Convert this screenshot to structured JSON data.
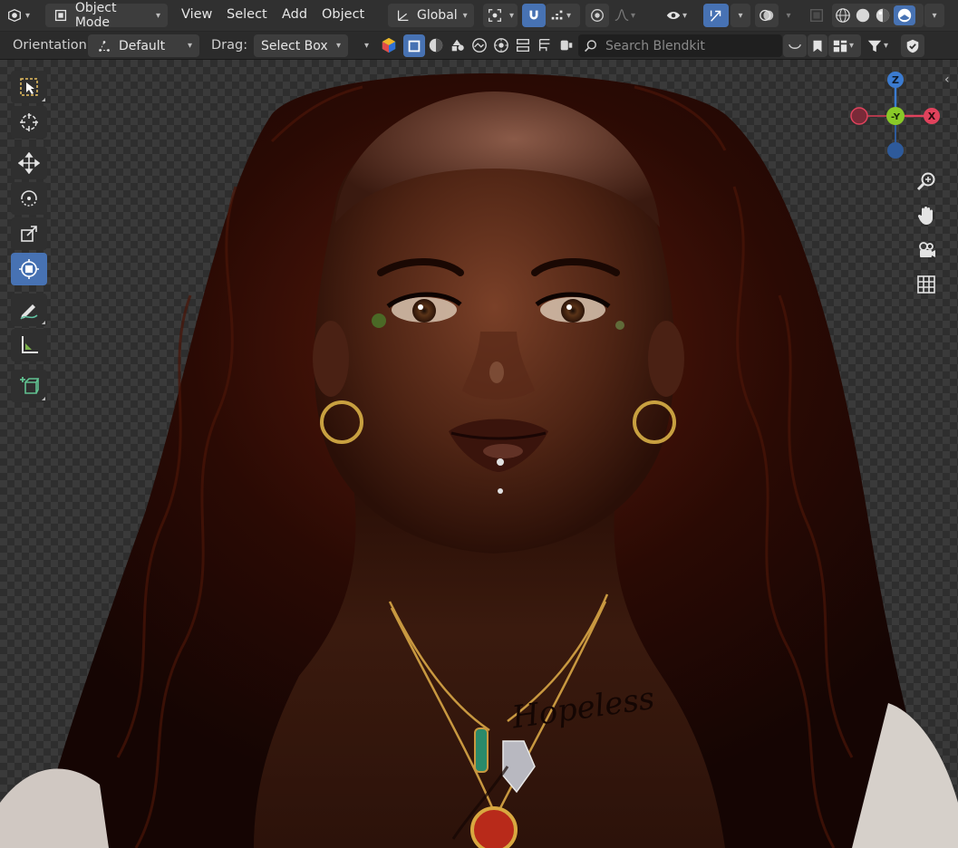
{
  "header": {
    "editor_type_icon": "camera-node-icon",
    "mode": {
      "label": "Object Mode",
      "icon": "object-mode-icon"
    },
    "menus": [
      "View",
      "Select",
      "Add",
      "Object"
    ],
    "transform_orientation": "Global",
    "pivot_icon": "pivot-point-icon",
    "snap_icon": "snap-magnet-icon",
    "snap_target_icon": "snap-increment-icon",
    "proportional_icon": "proportional-editing-icon",
    "falloff_icon": "falloff-curve-icon",
    "visibility_icon": "visibility-eye-icon",
    "gizmo_toggle_icon": "gizmo-arrow-icon",
    "overlay_icon": "overlays-icon",
    "xray_icon": "xray-icon",
    "shading_modes": [
      "wireframe",
      "solid",
      "material-preview",
      "rendered"
    ],
    "active_shading": "rendered"
  },
  "tool_settings": {
    "orientation_label": "Orientation:",
    "orientation_value": "Default",
    "drag_label": "Drag:",
    "drag_value": "Select Box",
    "search_placeholder": "Search Blendkit",
    "blendkit_icons": [
      "blendkit-logo-icon",
      "models-icon",
      "materials-icon",
      "printable-icon",
      "scenes-icon",
      "hdr-icon",
      "brushes-icon",
      "nodegroups-icon",
      "add-ons-icon"
    ]
  },
  "toolbar": {
    "tools": [
      {
        "name": "select-box-tool",
        "active": false
      },
      {
        "name": "cursor-tool",
        "active": false
      },
      {
        "name": "move-tool",
        "active": false
      },
      {
        "name": "rotate-tool",
        "active": false
      },
      {
        "name": "scale-tool",
        "active": false
      },
      {
        "name": "transform-tool",
        "active": true
      },
      {
        "name": "annotate-tool",
        "active": false
      },
      {
        "name": "measure-tool",
        "active": false
      },
      {
        "name": "add-cube-tool",
        "active": false
      }
    ]
  },
  "gizmo": {
    "z_label": "Z",
    "x_label": "X",
    "y_label": "-Y",
    "colors": {
      "x": "#e0425c",
      "y": "#89c928",
      "z": "#3b7bd0"
    }
  },
  "navigation": [
    "zoom-icon",
    "pan-hand-icon",
    "camera-view-icon",
    "ortho-grid-icon"
  ],
  "render_tattoo_text": "Hopeless",
  "colors": {
    "header_bg": "#303030",
    "accent": "#4772b3",
    "hair": "#3b1208",
    "skin": "#6a3620"
  }
}
